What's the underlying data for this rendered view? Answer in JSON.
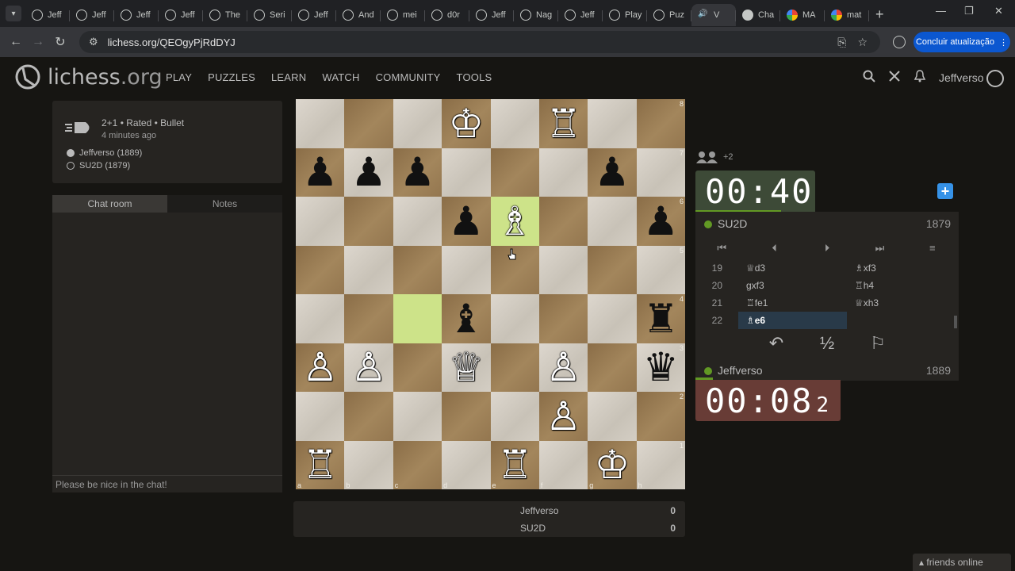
{
  "browser": {
    "tabs": [
      {
        "label": "Jeff",
        "icon": "lichess-icon"
      },
      {
        "label": "Jeff",
        "icon": "lichess-icon"
      },
      {
        "label": "Jeff",
        "icon": "lichess-icon"
      },
      {
        "label": "Jeff",
        "icon": "lichess-icon"
      },
      {
        "label": "The",
        "icon": "lichess-icon"
      },
      {
        "label": "Seri",
        "icon": "lichess-icon"
      },
      {
        "label": "Jeff",
        "icon": "lichess-icon"
      },
      {
        "label": "And",
        "icon": "lichess-icon"
      },
      {
        "label": "mei",
        "icon": "lichess-icon"
      },
      {
        "label": "d0r",
        "icon": "lichess-icon"
      },
      {
        "label": "Jeff",
        "icon": "lichess-icon"
      },
      {
        "label": "Nag",
        "icon": "lichess-icon"
      },
      {
        "label": "Jeff",
        "icon": "lichess-icon"
      },
      {
        "label": "Play",
        "icon": "lichess-icon"
      },
      {
        "label": "Puz",
        "icon": "lichess-icon"
      },
      {
        "label": "V",
        "icon": "speaker-icon",
        "active": true
      },
      {
        "label": "Cha",
        "icon": "chatgpt-icon"
      },
      {
        "label": "MA",
        "icon": "google-icon"
      },
      {
        "label": "mat",
        "icon": "google-icon"
      }
    ],
    "url": "lichess.org/QEOgyPjRdDYJ",
    "update_button": "Concluir atualização"
  },
  "site": {
    "logo_name": "lichess",
    "logo_tld": ".org",
    "nav": [
      "PLAY",
      "PUZZLES",
      "LEARN",
      "WATCH",
      "COMMUNITY",
      "TOOLS"
    ],
    "username": "Jeffverso"
  },
  "game_info": {
    "line1": "2+1 • Rated • Bullet",
    "line2": "4 minutes ago",
    "white_player": "Jeffverso (1889)",
    "black_player": "SU2D (1879)"
  },
  "chat": {
    "tab_chat": "Chat room",
    "tab_notes": "Notes",
    "placeholder": "Please be nice in the chat!"
  },
  "board": {
    "ranks": [
      "8",
      "7",
      "6",
      "5",
      "4",
      "3",
      "2",
      "1"
    ],
    "files": [
      "a",
      "b",
      "c",
      "d",
      "e",
      "f",
      "g",
      "h"
    ],
    "position": [
      [
        "",
        "",
        "",
        "wK",
        "",
        "wR",
        "",
        ""
      ],
      [
        "bP",
        "bP",
        "bP",
        "",
        "",
        "",
        "bP",
        ""
      ],
      [
        "",
        "",
        "",
        "bP",
        "wB",
        "",
        "",
        "bP"
      ],
      [
        "",
        "",
        "",
        "",
        "",
        "",
        "",
        ""
      ],
      [
        "",
        "",
        "",
        "bB",
        "",
        "",
        "",
        "bR"
      ],
      [
        "wP",
        "wP",
        "",
        "wQ",
        "",
        "wP",
        "",
        "bQ"
      ],
      [
        "",
        "",
        "",
        "",
        "",
        "wP",
        "",
        ""
      ],
      [
        "wR",
        "",
        "",
        "",
        "wR",
        "",
        "wK",
        ""
      ]
    ],
    "highlights": [
      "e6",
      "c4"
    ]
  },
  "crosstable": {
    "rows": [
      {
        "name": "Jeffverso",
        "score": "0"
      },
      {
        "name": "SU2D",
        "score": "0"
      }
    ]
  },
  "right_panel": {
    "spectators": "+2",
    "top_clock": {
      "main": "00:40"
    },
    "top_player": {
      "name": "SU2D",
      "rating": "1879"
    },
    "moves": [
      {
        "num": "19",
        "white": "♕d3",
        "black": "♗xf3"
      },
      {
        "num": "20",
        "white": "gxf3",
        "black": "♖h4"
      },
      {
        "num": "21",
        "white": "♖fe1",
        "black": "♕xh3"
      },
      {
        "num": "22",
        "white": "♗e6",
        "black": ""
      }
    ],
    "bottom_player": {
      "name": "Jeffverso",
      "rating": "1889"
    },
    "bottom_clock": {
      "main": "00:08",
      "tenths": "2"
    }
  },
  "footer": {
    "friends": "friends online"
  }
}
